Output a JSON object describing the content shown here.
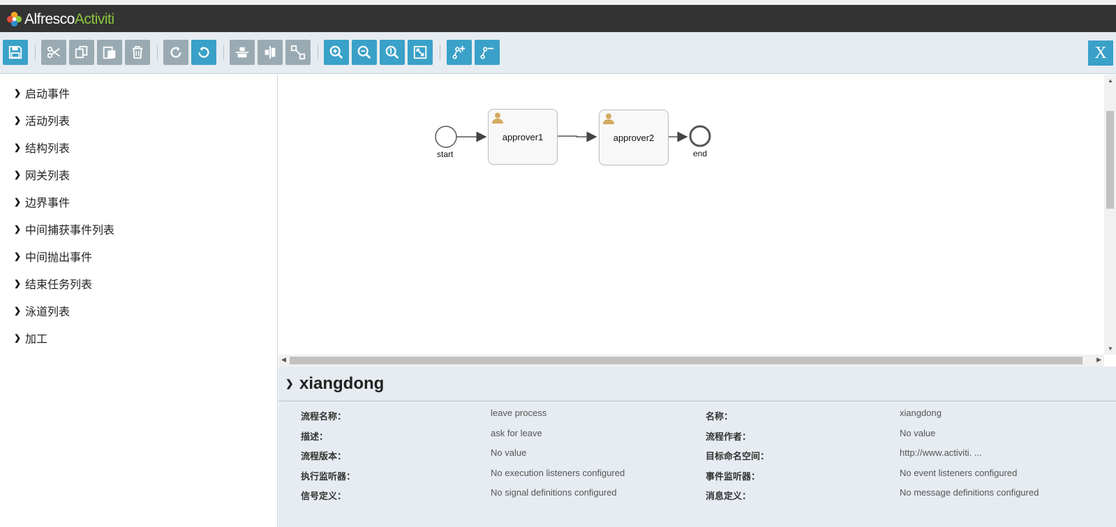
{
  "app": {
    "logo_primary": "Alfresco",
    "logo_secondary": "Activiti",
    "accent_color": "#3aa1c8",
    "header_color": "#333333"
  },
  "toolbar": {
    "buttons": [
      {
        "name": "save-icon",
        "tooltip": ""
      },
      {
        "name": "cut-icon"
      },
      {
        "name": "copy-icon"
      },
      {
        "name": "paste-icon"
      },
      {
        "name": "delete-icon"
      },
      {
        "name": "redo-icon"
      },
      {
        "name": "undo-icon"
      },
      {
        "name": "align-horizontal-icon"
      },
      {
        "name": "align-vertical-icon"
      },
      {
        "name": "same-size-icon"
      },
      {
        "name": "zoom-in-icon"
      },
      {
        "name": "zoom-out-icon"
      },
      {
        "name": "zoom-actual-icon"
      },
      {
        "name": "zoom-fit-icon"
      },
      {
        "name": "add-bendpoint-icon"
      },
      {
        "name": "remove-bendpoint-icon"
      }
    ],
    "close_label": "X"
  },
  "palette": {
    "items": [
      {
        "label": "启动事件"
      },
      {
        "label": "活动列表"
      },
      {
        "label": "结构列表"
      },
      {
        "label": "网关列表"
      },
      {
        "label": "边界事件"
      },
      {
        "label": "中间捕获事件列表"
      },
      {
        "label": "中间抛出事件"
      },
      {
        "label": "结束任务列表"
      },
      {
        "label": "泳道列表"
      },
      {
        "label": "加工"
      }
    ]
  },
  "diagram": {
    "start_label": "start",
    "end_label": "end",
    "tasks": [
      {
        "name": "approver1",
        "icon": "user-icon"
      },
      {
        "name": "approver2",
        "icon": "user-icon"
      }
    ]
  },
  "properties": {
    "title": "xiangdong",
    "left": [
      {
        "label": "流程名称：",
        "value": "leave process"
      },
      {
        "label": "描述：",
        "value": "ask for leave"
      },
      {
        "label": "流程版本：",
        "value": "No value"
      },
      {
        "label": "执行监听器：",
        "value": "No execution listeners configured"
      },
      {
        "label": "信号定义：",
        "value": "No signal definitions configured"
      }
    ],
    "right": [
      {
        "label": "名称：",
        "value": "xiangdong"
      },
      {
        "label": "流程作者：",
        "value": "No value"
      },
      {
        "label": "目标命名空间：",
        "value": "http://www.activiti. ..."
      },
      {
        "label": "事件监听器：",
        "value": "No event listeners configured"
      },
      {
        "label": "消息定义：",
        "value": "No message definitions configured"
      }
    ]
  }
}
